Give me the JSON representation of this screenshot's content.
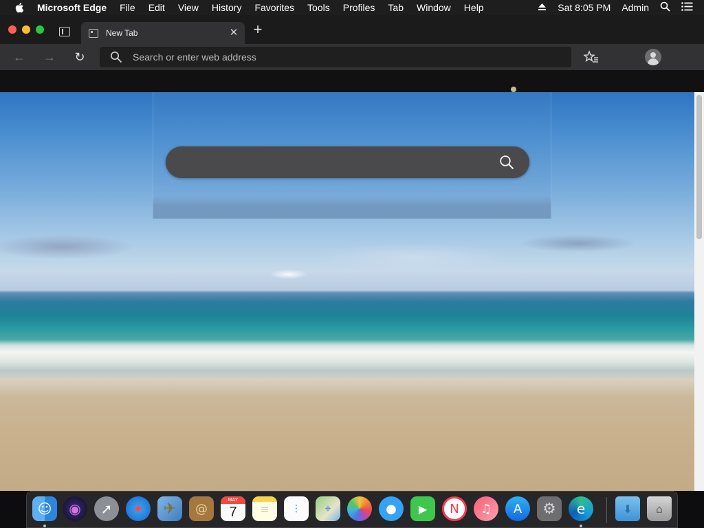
{
  "menubar": {
    "app_name": "Microsoft Edge",
    "items": [
      "File",
      "Edit",
      "View",
      "History",
      "Favorites",
      "Tools",
      "Profiles",
      "Tab",
      "Window",
      "Help"
    ],
    "clock": "Sat 8:05 PM",
    "user": "Admin",
    "icons": [
      "apple-icon",
      "eject-icon",
      "spotlight-icon",
      "notification-center-icon"
    ]
  },
  "window": {
    "traffic_lights": [
      "close",
      "minimize",
      "zoom"
    ],
    "tab": {
      "title": "New Tab",
      "close_glyph": "✕"
    },
    "new_tab_glyph": "+"
  },
  "toolbar": {
    "back_glyph": "←",
    "forward_glyph": "→",
    "reload_glyph": "↻",
    "address_placeholder": "Search or enter web address",
    "address_value": ""
  },
  "page": {
    "search_placeholder": "",
    "background": "beach"
  },
  "dock": {
    "apps": [
      "Finder",
      "Siri",
      "Launchpad",
      "Safari",
      "Mail",
      "Contacts",
      "Calendar",
      "Notes",
      "Reminders",
      "Maps",
      "Photos",
      "Messages",
      "FaceTime",
      "News",
      "Music",
      "App Store",
      "System Preferences",
      "Microsoft Edge",
      "Downloads",
      "Trash"
    ],
    "calendar": {
      "month": "MAY",
      "day": "7"
    }
  },
  "colors": {
    "menubar_bg": "#1e1e1f",
    "tab_bg": "#323234",
    "omnibox_bg": "#1f1f20",
    "search_bar_bg": "#4a4a4c",
    "dock_bg": "#28282a"
  }
}
